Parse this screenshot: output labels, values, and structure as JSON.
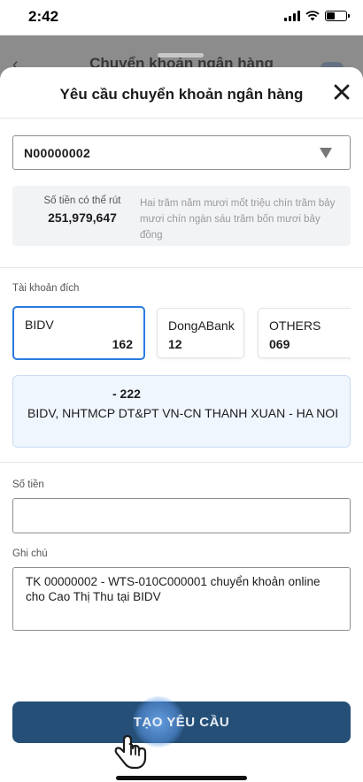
{
  "status_bar": {
    "time": "2:42",
    "battery_level": 0.45
  },
  "background_screen": {
    "title": "Chuyển khoản ngân hàng"
  },
  "sheet": {
    "title": "Yêu cầu chuyển khoản ngân hàng",
    "close_icon": "close-icon"
  },
  "account": {
    "selected": "N00000002",
    "dropdown_icon": "triangle-down-icon"
  },
  "balance": {
    "label": "Số tiền có thể rút",
    "value": "251,979,647",
    "in_words": "Hai trăm năm mươi mốt triệu chín trăm bảy mươi chín ngàn sáu trăm bốn mươi bảy đồng"
  },
  "destination": {
    "label": "Tài khoản đích",
    "banks": [
      {
        "name": "BIDV",
        "code": "162",
        "selected": true
      },
      {
        "name": "DongABank",
        "code": "12",
        "selected": false
      },
      {
        "name": "OTHERS",
        "code": "069",
        "selected": false
      }
    ],
    "info_line1": "- 222",
    "info_line2": "BIDV, NHTMCP DT&PT VN-CN THANH XUAN - HA NOI"
  },
  "amount": {
    "label": "Số tiền",
    "value": ""
  },
  "note": {
    "label": "Ghi chú",
    "value": "TK 00000002 - WTS-010C000001 chuyển khoản online cho Cao Thị Thu tại BIDV"
  },
  "submit": {
    "label": "TẠO YÊU CẦU",
    "tap_icon": "hand-pointer-icon"
  },
  "colors": {
    "primary": "#254f77",
    "selected_border": "#2b7be0",
    "info_bg": "#f0f6fd"
  }
}
